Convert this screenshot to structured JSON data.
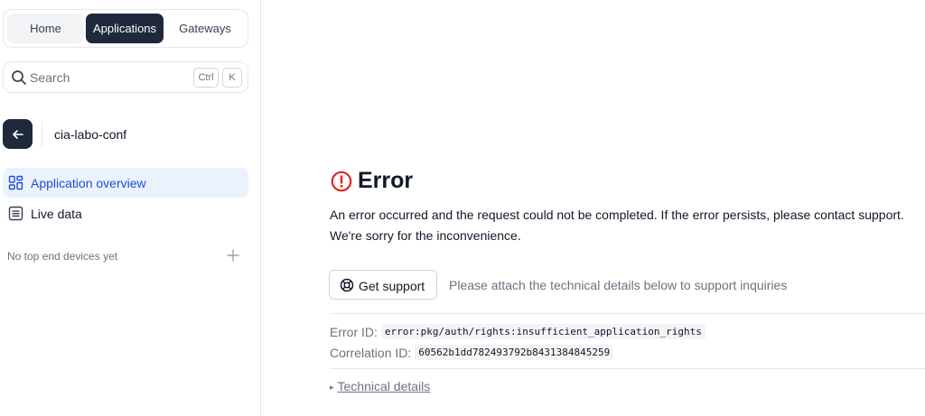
{
  "nav_tabs": {
    "home": "Home",
    "applications": "Applications",
    "gateways": "Gateways"
  },
  "search": {
    "placeholder": "Search",
    "shortcut_key1": "Ctrl",
    "shortcut_key2": "K"
  },
  "application": {
    "name": "cia-labo-conf"
  },
  "sidebar_nav": {
    "overview": "Application overview",
    "live_data": "Live data"
  },
  "devices": {
    "empty_text": "No top end devices yet"
  },
  "error": {
    "title": "Error",
    "message_line1": "An error occurred and the request could not be completed. If the error persists, please contact support.",
    "message_line2": "We're sorry for the inconvenience.",
    "support_button": "Get support",
    "support_hint": "Please attach the technical details below to support inquiries",
    "error_id_label": "Error ID:",
    "error_id_value": "error:pkg/auth/rights:insufficient_application_rights",
    "correlation_id_label": "Correlation ID:",
    "correlation_id_value": "60562b1dd782493792b8431384845259",
    "technical_details": "Technical details",
    "technical_details_marker": "▸"
  },
  "colors": {
    "dark_navy": "#1e293b",
    "active_nav_bg": "#eaf2fd",
    "active_nav_text": "#1d4ed8",
    "error_red": "#dc2626"
  },
  "icons": {
    "search": "search-icon",
    "back": "arrow-left-icon",
    "overview": "grid-icon",
    "live_data": "list-icon",
    "add": "plus-icon",
    "error": "alert-circle-icon",
    "support": "lifebuoy-icon"
  }
}
